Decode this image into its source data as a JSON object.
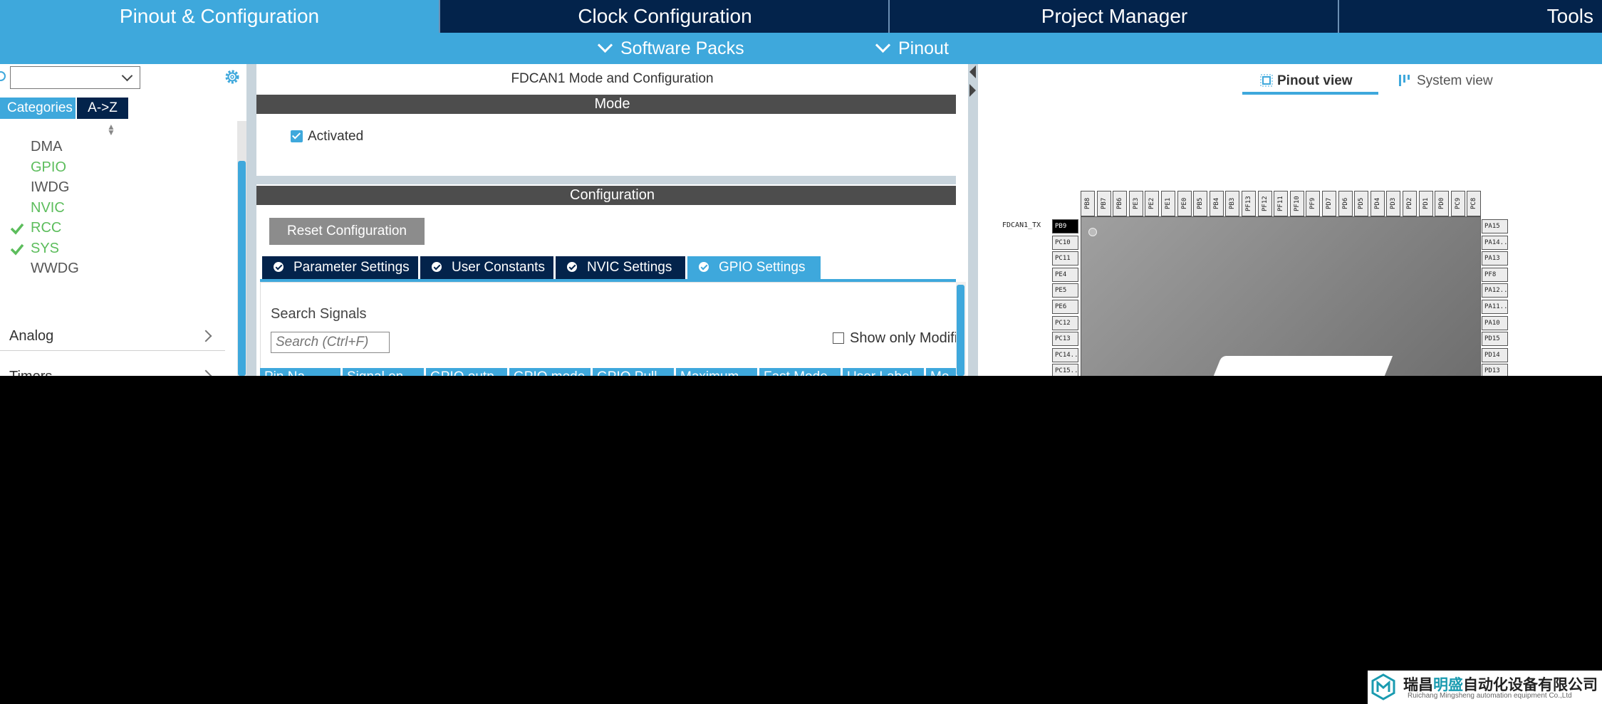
{
  "top_tabs": [
    "Pinout & Configuration",
    "Clock Configuration",
    "Project Manager",
    "Tools"
  ],
  "sub_menu": [
    "Software Packs",
    "Pinout"
  ],
  "left_panel": {
    "category_tabs": [
      "Categories",
      "A->Z"
    ],
    "tree_items": [
      {
        "label": "DMA",
        "state": "normal"
      },
      {
        "label": "GPIO",
        "state": "green"
      },
      {
        "label": "IWDG",
        "state": "normal"
      },
      {
        "label": "NVIC",
        "state": "green"
      },
      {
        "label": "RCC",
        "state": "checked"
      },
      {
        "label": "SYS",
        "state": "checked"
      },
      {
        "label": "WWDG",
        "state": "normal"
      }
    ],
    "groups": [
      "Analog",
      "Timers"
    ]
  },
  "mid_panel": {
    "title": "FDCAN1 Mode and Configuration",
    "mode_header": "Mode",
    "activated_label": "Activated",
    "activated_checked": true,
    "configuration_header": "Configuration",
    "reset_button": "Reset Configuration",
    "config_tabs": [
      {
        "label": "Parameter Settings",
        "active": false
      },
      {
        "label": "User Constants",
        "active": false
      },
      {
        "label": "NVIC Settings",
        "active": false
      },
      {
        "label": "GPIO Settings",
        "active": true
      }
    ],
    "search_label": "Search Signals",
    "search_placeholder": "Search (Ctrl+F)",
    "show_only_label": "Show only Modifi",
    "table_columns": [
      "Pin Na...",
      "Signal on...",
      "GPIO outp...",
      "GPIO mode",
      "GPIO Pull-...",
      "Maximum...",
      "Fast Mode",
      "User Label",
      "Mo"
    ]
  },
  "right_panel": {
    "view_tabs": [
      "Pinout view",
      "System view"
    ],
    "pin_label": "FDCAN1_TX",
    "top_pins": [
      "PB8",
      "PB7",
      "PB6",
      "PE3",
      "PE2",
      "PE1",
      "PE0",
      "PB5",
      "PB4",
      "PB3",
      "PF13",
      "PF12",
      "PF11",
      "PF10",
      "PF9",
      "PD7",
      "PD6",
      "PD5",
      "PD4",
      "PD3",
      "PD2",
      "PD1",
      "PD0",
      "PC9",
      "PC8"
    ],
    "left_pins": [
      "PB9",
      "PC10",
      "PC11",
      "PE4",
      "PE5",
      "PE6",
      "PC12",
      "PC13",
      "PC14..",
      "PC15.."
    ],
    "right_pins": [
      "PA15",
      "PA14..",
      "PA13",
      "PF8",
      "PA12..",
      "PA11..",
      "PA10",
      "PD15",
      "PD14",
      "PD13"
    ]
  },
  "watermark": {
    "brand_pre": "瑞昌",
    "brand_mid": "明盛",
    "brand_post": "自动化设备有限公司",
    "subtitle": "Ruichang Mingsheng automation equipment Co.,Ltd"
  },
  "colors": {
    "accent": "#3ea8dc",
    "dark_navy": "#03234b",
    "green": "#5cbd5c"
  }
}
